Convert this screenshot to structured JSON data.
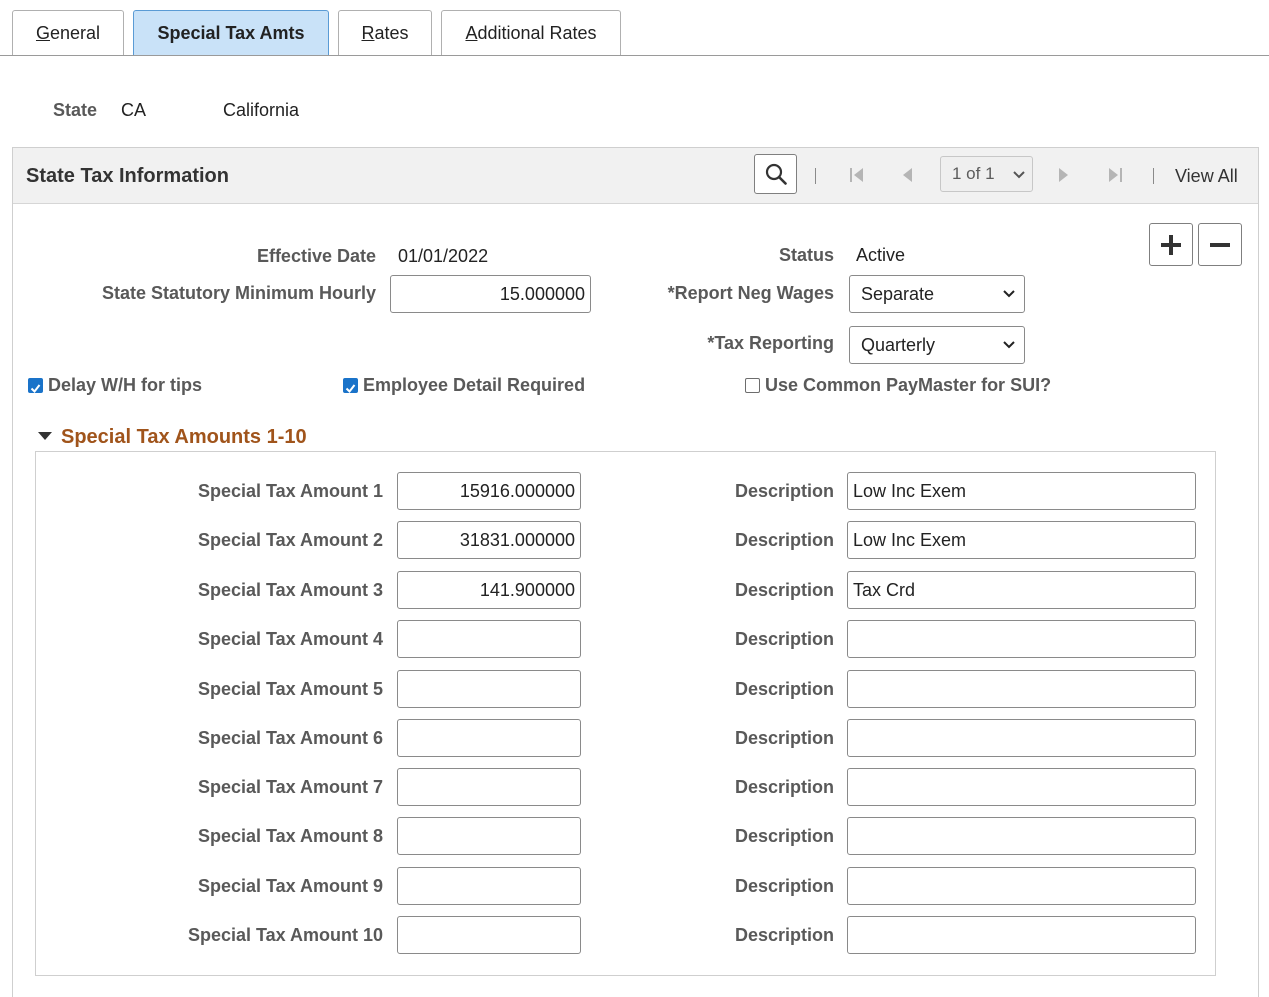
{
  "tabs": [
    {
      "label": "General",
      "underline": "G",
      "rest": "eneral",
      "active": false
    },
    {
      "label": "Special Tax Amts",
      "active": true
    },
    {
      "label": "Rates",
      "underline": "R",
      "rest": "ates",
      "active": false
    },
    {
      "label": "Additional Rates",
      "underline": "A",
      "rest": "dditional Rates",
      "active": false
    }
  ],
  "state": {
    "label": "State",
    "code": "CA",
    "name": "California"
  },
  "section": {
    "title": "State Tax Information",
    "pager": {
      "text": "1 of 1",
      "view_all": "View All"
    }
  },
  "form": {
    "effective_date_label": "Effective Date",
    "effective_date": "01/01/2022",
    "status_label": "Status",
    "status": "Active",
    "min_hourly_label": "State Statutory Minimum Hourly",
    "min_hourly": "15.000000",
    "report_neg_wages_label": "*Report Neg Wages",
    "report_neg_wages": "Separate",
    "tax_reporting_label": "*Tax Reporting",
    "tax_reporting": "Quarterly",
    "delay_wh_label": "Delay W/H for tips",
    "delay_wh_checked": true,
    "employee_detail_label": "Employee Detail Required",
    "employee_detail_checked": true,
    "common_paymaster_label": "Use Common PayMaster for SUI?",
    "common_paymaster_checked": false
  },
  "special": {
    "title": "Special Tax Amounts 1-10",
    "description_label": "Description",
    "rows": [
      {
        "label": "Special Tax Amount 1",
        "amount": "15916.000000",
        "description": "Low Inc Exem"
      },
      {
        "label": "Special Tax Amount 2",
        "amount": "31831.000000",
        "description": "Low Inc Exem"
      },
      {
        "label": "Special Tax Amount 3",
        "amount": "141.900000",
        "description": "Tax Crd"
      },
      {
        "label": "Special Tax Amount 4",
        "amount": "",
        "description": ""
      },
      {
        "label": "Special Tax Amount 5",
        "amount": "",
        "description": ""
      },
      {
        "label": "Special Tax Amount 6",
        "amount": "",
        "description": ""
      },
      {
        "label": "Special Tax Amount 7",
        "amount": "",
        "description": ""
      },
      {
        "label": "Special Tax Amount 8",
        "amount": "",
        "description": ""
      },
      {
        "label": "Special Tax Amount 9",
        "amount": "",
        "description": ""
      },
      {
        "label": "Special Tax Amount 10",
        "amount": "",
        "description": ""
      }
    ]
  },
  "icons": {
    "search": "search-icon",
    "first": "first-page-icon",
    "prev": "previous-icon",
    "next": "next-icon",
    "last": "last-page-icon",
    "add": "add-row-icon",
    "delete": "delete-row-icon",
    "collapse": "collapse-triangle-icon"
  },
  "colors": {
    "active_tab": "#c9e2f8",
    "checkbox": "#1a73c9",
    "collapsible_title": "#a0541b"
  }
}
